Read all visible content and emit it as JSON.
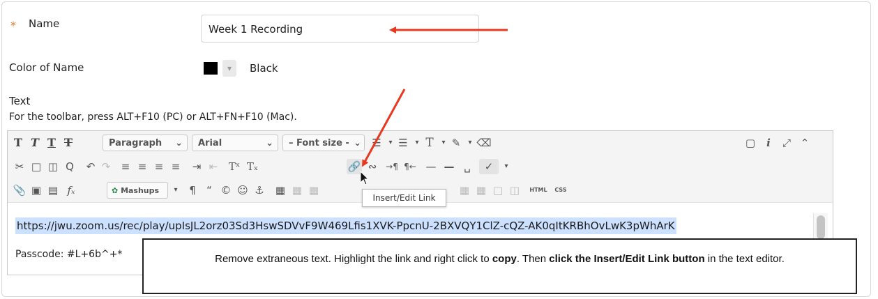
{
  "form": {
    "required_mark": "*",
    "name_label": "Name",
    "name_value": "Week 1 Recording",
    "color_label": "Color of Name",
    "color_value": "Black",
    "text_label": "Text",
    "toolbar_hint": "For the toolbar, press ALT+F10 (PC) or ALT+FN+F10 (Mac)."
  },
  "toolbar": {
    "paragraph_select": "Paragraph",
    "font_select": "Arial",
    "font_size_select": "– Font size -",
    "mashups_label": "Mashups",
    "html_label": "HTML",
    "css_label": "CSS",
    "tooltip": "Insert/Edit Link"
  },
  "editor": {
    "link_text": "https://jwu.zoom.us/rec/play/upIsJL2orz03Sd3HswSDVvF9W469Lfis1XVK-PpcnU-2BXVQY1ClZ-cQZ-AK0qItKRBhOvLwK3pWhArK",
    "passcode_text": "Passcode: #L+6b^+*"
  },
  "callout": {
    "part1": "Remove extraneous text. Highlight the link and right click to ",
    "bold1": "copy",
    "part2": ". Then ",
    "bold2": "click the Insert/Edit Link button",
    "part3": " in the text editor."
  },
  "colors": {
    "accent_arrow": "#e8381f",
    "required": "#e07b2a",
    "highlight": "#cce0ff"
  },
  "icons": [
    "bold-icon",
    "italic-icon",
    "underline-icon",
    "strikethrough-icon",
    "cut-icon",
    "copy-icon",
    "paste-icon",
    "find-icon",
    "undo-icon",
    "redo-icon",
    "align-left-icon",
    "align-center-icon",
    "align-right-icon",
    "justify-icon",
    "indent-icon",
    "outdent-icon",
    "superscript-icon",
    "subscript-icon",
    "link-icon",
    "unlink-icon",
    "ltr-icon",
    "rtl-icon",
    "hr-icon",
    "spellcheck-icon",
    "attach-icon",
    "image-icon",
    "media-icon",
    "formula-icon",
    "paragraph-mark-icon",
    "quote-icon",
    "copyright-icon",
    "emoji-icon",
    "anchor-icon",
    "table-icon",
    "preview-icon",
    "info-icon",
    "fullscreen-icon",
    "collapse-icon"
  ]
}
